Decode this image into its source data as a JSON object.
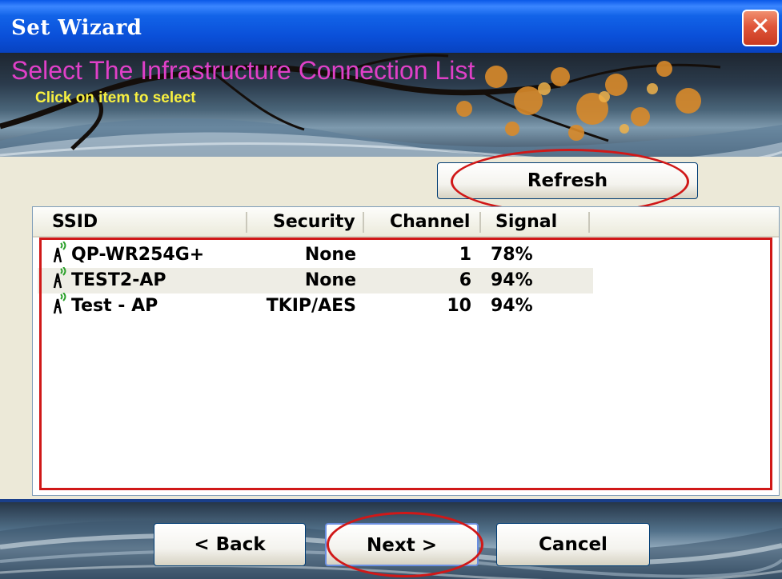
{
  "window": {
    "title": "Set Wizard",
    "close_glyph": "✕",
    "icon": "close-icon"
  },
  "banner": {
    "headline": "Select The Infrastructure Connection List",
    "subtitle": "Click on item to select"
  },
  "toolbar": {
    "refresh_label": "Refresh"
  },
  "list": {
    "columns": [
      "SSID",
      "Security",
      "Channel",
      "Signal"
    ],
    "rows": [
      {
        "ssid": "QP-WR254G+",
        "security": "None",
        "channel": "1",
        "signal": "78%",
        "icon": "access-point-icon"
      },
      {
        "ssid": "TEST2-AP",
        "security": "None",
        "channel": "6",
        "signal": "94%",
        "icon": "access-point-icon"
      },
      {
        "ssid": "Test - AP",
        "security": "TKIP/AES",
        "channel": "10",
        "signal": "94%",
        "icon": "access-point-icon"
      }
    ]
  },
  "footer": {
    "back_label": "< Back",
    "next_label": "Next >",
    "cancel_label": "Cancel"
  },
  "colors": {
    "headline": "#e040c8",
    "subtitle": "#f8f040",
    "annotation_red": "#d01818",
    "titlebar_blue": "#0a4fd8"
  }
}
